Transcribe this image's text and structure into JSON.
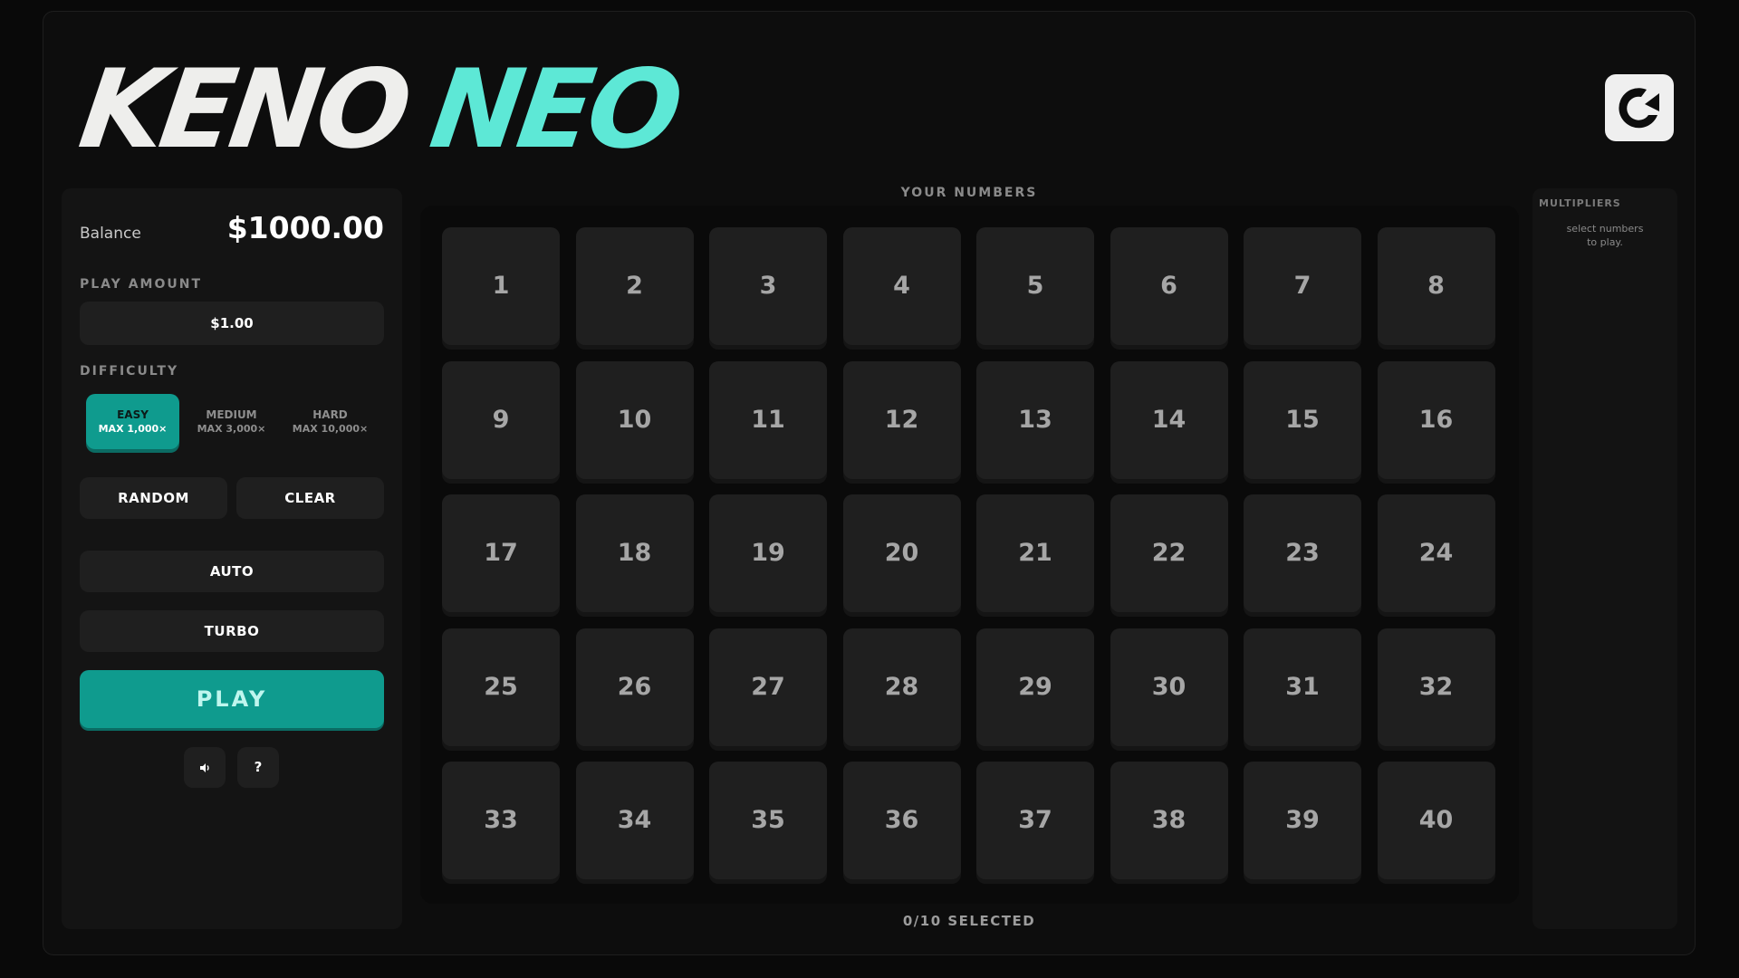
{
  "header": {
    "title_part1": "KENO",
    "title_part2": "NEO",
    "brand_icon": "brand-logo-icon"
  },
  "sidebar": {
    "balance_label": "Balance",
    "balance_value": "$1000.00",
    "play_amount_label": "PLAY AMOUNT",
    "play_amount_value": "$1.00",
    "difficulty_label": "DIFFICULTY",
    "difficulties": [
      {
        "name": "EASY",
        "max": "MAX 1,000×",
        "selected": true
      },
      {
        "name": "MEDIUM",
        "max": "MAX 3,000×",
        "selected": false
      },
      {
        "name": "HARD",
        "max": "MAX 10,000×",
        "selected": false
      }
    ],
    "random_label": "RANDOM",
    "clear_label": "CLEAR",
    "auto_label": "AUTO",
    "turbo_label": "TURBO",
    "play_label": "PLAY",
    "sound_icon": "sound-icon",
    "help_label": "?"
  },
  "board": {
    "heading": "YOUR NUMBERS",
    "numbers": [
      "1",
      "2",
      "3",
      "4",
      "5",
      "6",
      "7",
      "8",
      "9",
      "10",
      "11",
      "12",
      "13",
      "14",
      "15",
      "16",
      "17",
      "18",
      "19",
      "20",
      "21",
      "22",
      "23",
      "24",
      "25",
      "26",
      "27",
      "28",
      "29",
      "30",
      "31",
      "32",
      "33",
      "34",
      "35",
      "36",
      "37",
      "38",
      "39",
      "40"
    ],
    "selected_text": "0/10 SELECTED"
  },
  "multipliers": {
    "heading": "MULTIPLIERS",
    "hint": "select numbers to play."
  },
  "colors": {
    "accent": "#0f9b8e",
    "title_accent": "#5de8d6",
    "background": "#0d0d0d",
    "tile": "#1f1f1f"
  }
}
